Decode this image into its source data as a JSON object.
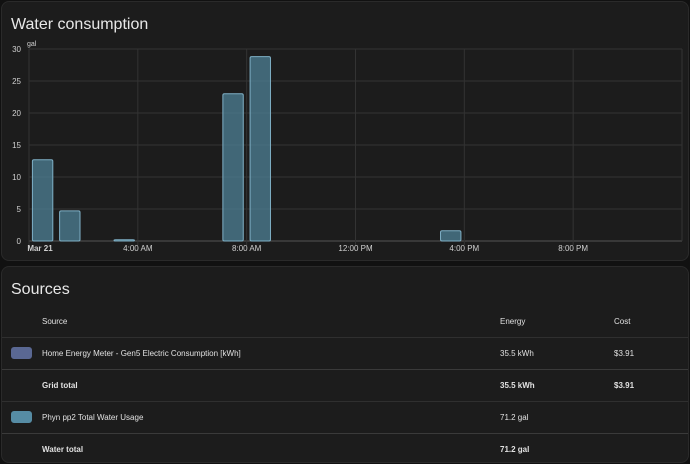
{
  "chart_card": {
    "title": "Water consumption"
  },
  "chart_data": {
    "type": "bar",
    "unit_label": "gal",
    "ylim": [
      0,
      30
    ],
    "y_ticks": [
      0,
      5,
      10,
      15,
      20,
      25,
      30
    ],
    "x_ticks": [
      {
        "label": "Mar 21",
        "hour": 0,
        "bold": true
      },
      {
        "label": "4:00 AM",
        "hour": 4
      },
      {
        "label": "8:00 AM",
        "hour": 8
      },
      {
        "label": "12:00 PM",
        "hour": 12
      },
      {
        "label": "4:00 PM",
        "hour": 16
      },
      {
        "label": "8:00 PM",
        "hour": 20
      }
    ],
    "xlim": [
      0,
      24
    ],
    "series": [
      {
        "color": "#4b7a8f",
        "points": [
          {
            "hour": 0,
            "value": 12.7
          },
          {
            "hour": 1,
            "value": 4.7
          },
          {
            "hour": 3,
            "value": 0.2
          },
          {
            "hour": 7,
            "value": 23.0
          },
          {
            "hour": 8,
            "value": 28.8
          },
          {
            "hour": 15,
            "value": 1.6
          }
        ]
      }
    ],
    "grid": true
  },
  "sources_card": {
    "title": "Sources",
    "headers": {
      "source": "Source",
      "energy": "Energy",
      "cost": "Cost"
    },
    "rows": [
      {
        "type": "source",
        "swatch": "#4e5a80",
        "source": "Home Energy Meter - Gen5 Electric Consumption [kWh]",
        "energy": "35.5 kWh",
        "cost": "$3.91"
      },
      {
        "type": "total",
        "source": "Grid total",
        "energy": "35.5 kWh",
        "cost": "$3.91"
      },
      {
        "type": "source",
        "swatch": "#4b7a8f",
        "source": "Phyn pp2 Total Water Usage",
        "energy": "71.2 gal",
        "cost": ""
      },
      {
        "type": "total",
        "source": "Water total",
        "energy": "71.2 gal",
        "cost": ""
      }
    ]
  }
}
